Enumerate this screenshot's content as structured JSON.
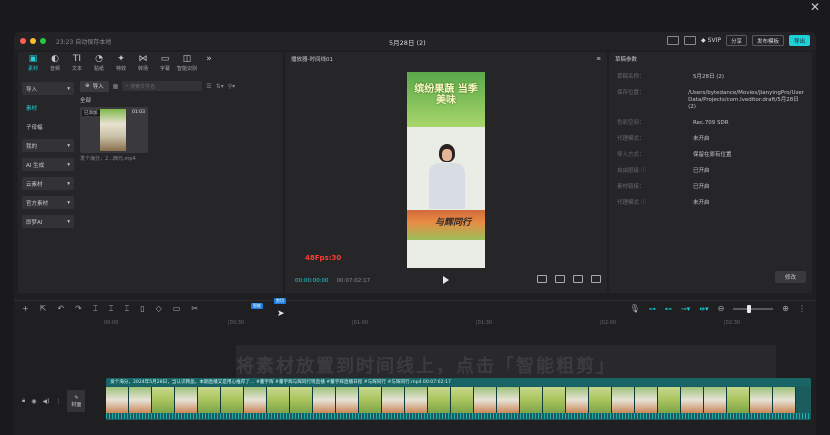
{
  "outer": {
    "close_glyph": "✕"
  },
  "titlebar": {
    "status": "23:23 自动保存本地",
    "title": "5月28日 (2)",
    "svip": "SVIP",
    "share": "分享",
    "publish": "发布模板",
    "export": "导出"
  },
  "left": {
    "tools": [
      {
        "glyph": "▣",
        "label": "素材"
      },
      {
        "glyph": "◐",
        "label": "音频"
      },
      {
        "glyph": "TI",
        "label": "文本"
      },
      {
        "glyph": "◔",
        "label": "贴纸"
      },
      {
        "glyph": "✦",
        "label": "特效"
      },
      {
        "glyph": "⋈",
        "label": "转场"
      },
      {
        "glyph": "▭",
        "label": "字幕"
      },
      {
        "glyph": "◫",
        "label": "智能识别"
      }
    ],
    "nav": {
      "import": "导入",
      "material": "素材",
      "subtitle": "子母幅",
      "mine": "我的",
      "ai": "AI 生成",
      "cloud": "云素材",
      "official": "官方素材",
      "smart_ai": "即梦AI"
    },
    "import_btn": "导入",
    "search_placeholder": "搜索文件名",
    "all_label": "全部",
    "clip": {
      "badge": "已添加",
      "duration": "01:03",
      "name": "发个海分，2...西元.mp4"
    }
  },
  "player": {
    "title": "播放器-时间线01",
    "preview_title": "缤纷果蔬 当季美味",
    "preview_sign": "与辉同行",
    "fps": "48Fps:30",
    "tc_current": "00:00:00:00",
    "tc_total": "00:07:02:17"
  },
  "props": {
    "title": "草稿参数",
    "rows": [
      {
        "k": "草稿名称：",
        "v": "5月28日 (2)"
      },
      {
        "k": "保存位置：",
        "v": "/Users/bytedance/Movies/JianyingPro/User Data/Projects/com.lveditor.draft/5月28日 (2)"
      },
      {
        "k": "色彩空间：",
        "v": "Rec.709 SDR"
      },
      {
        "k": "代理模式：",
        "v": "未开启"
      },
      {
        "k": "导入方式：",
        "v": "保留在原有位置"
      },
      {
        "k": "自由层级 ⓘ",
        "v": "已开启"
      },
      {
        "k": "素材链接：",
        "v": "已开启"
      },
      {
        "k": "代理模式 ⓘ",
        "v": "未开启"
      }
    ],
    "modify": "修改"
  },
  "timeline": {
    "tools_left": [
      "+",
      "⇱",
      "↶",
      "↷",
      "⌶",
      "⌶",
      "⌶",
      "▯",
      "◇",
      "▭",
      "✂"
    ],
    "ruler": [
      "00:00",
      "|00:30",
      "|01:00",
      "|01:30",
      "|02:00",
      "|02:30",
      "|03:00",
      "|03:30"
    ],
    "overlay": "将素材放置到时间线上，点击「智能粗剪」",
    "cover": "封面",
    "track_info": "发个海分，2024年5月28日，当认识韩晶，本期直播又是用心推荐了…  #董宇辉  #董宇辉与辉同行现直播  #董宇辉直播日程  #与辉同行  #与辉同行.mp4   00:07:02:17",
    "tip1": "智能",
    "tip2": "剪切"
  }
}
